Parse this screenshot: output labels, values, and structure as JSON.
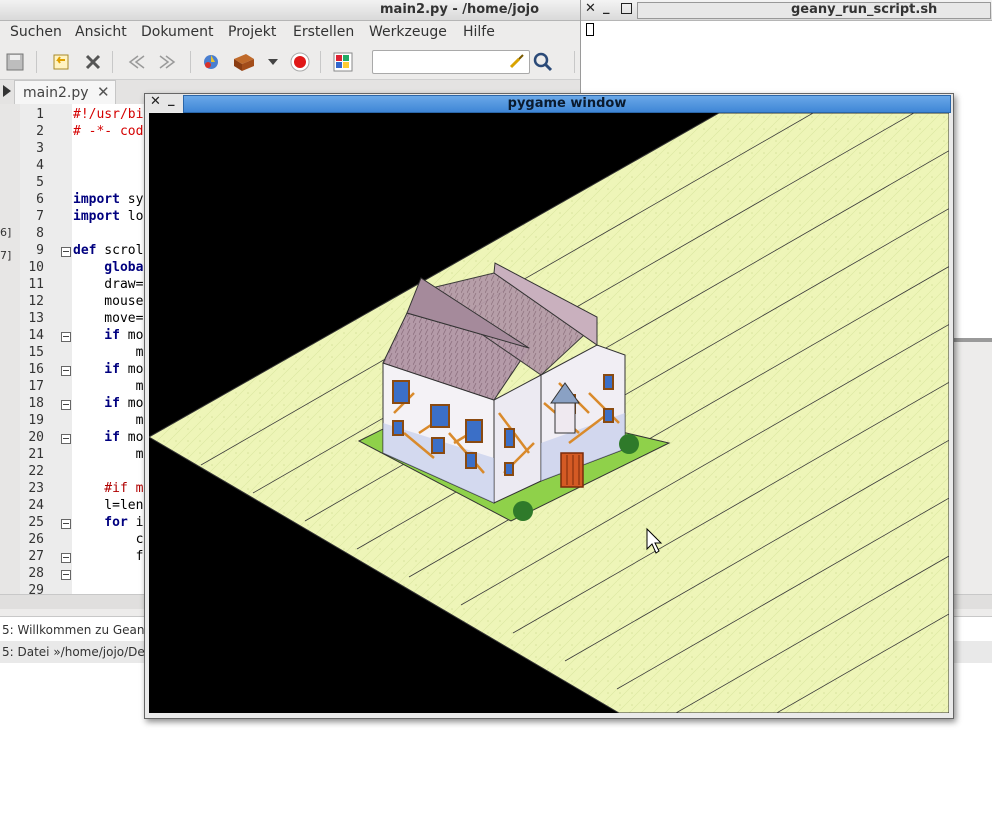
{
  "geany": {
    "title": "main2.py - /home/jojo",
    "menu": [
      "Suchen",
      "Ansicht",
      "Dokument",
      "Projekt",
      "Erstellen",
      "Werkzeuge",
      "Hilfe"
    ],
    "tab_label": "main2.py",
    "left_strip_numbers": [
      "6]",
      "7]"
    ],
    "lines": [
      {
        "n": "1",
        "text": "#!/usr/bi"
      },
      {
        "n": "2",
        "text": "# -*- cod"
      },
      {
        "n": "3",
        "text": ""
      },
      {
        "n": "4",
        "text": ""
      },
      {
        "n": "5",
        "text": ""
      },
      {
        "n": "6",
        "kw": "import",
        "text": " sy"
      },
      {
        "n": "7",
        "kw": "import",
        "text": " lo"
      },
      {
        "n": "8",
        "text": ""
      },
      {
        "n": "9",
        "kw": "def",
        "text": " scrol"
      },
      {
        "n": "10",
        "kw": "    globa",
        "text": ""
      },
      {
        "n": "11",
        "text": "    draw="
      },
      {
        "n": "12",
        "text": "    mouse"
      },
      {
        "n": "13",
        "text": "    move="
      },
      {
        "n": "14",
        "kw": "    if",
        "text": " mo"
      },
      {
        "n": "15",
        "text": "        m"
      },
      {
        "n": "16",
        "kw": "    if",
        "text": " mo"
      },
      {
        "n": "17",
        "text": "        m"
      },
      {
        "n": "18",
        "kw": "    if",
        "text": " mo"
      },
      {
        "n": "19",
        "text": "        m"
      },
      {
        "n": "20",
        "kw": "    if",
        "text": " mo"
      },
      {
        "n": "21",
        "text": "        m"
      },
      {
        "n": "22",
        "text": ""
      },
      {
        "n": "23",
        "text": "    #if m"
      },
      {
        "n": "24",
        "text": "    l=len"
      },
      {
        "n": "25",
        "kw": "    for",
        "text": " i"
      },
      {
        "n": "26",
        "text": "        c"
      },
      {
        "n": "27",
        "text": "        f"
      },
      {
        "n": "28",
        "text": ""
      },
      {
        "n": "29",
        "text": ""
      }
    ],
    "messages": [
      "5: Willkommen zu Gean",
      "5: Datei »/home/jojo/De"
    ]
  },
  "terminal": {
    "title": "geany_run_script.sh"
  },
  "pygame": {
    "title": "pygame window"
  },
  "colors": {
    "grass": "#eef5b8",
    "grass_line": "#3a3a3a",
    "titlebar_blue": "#4a90dd",
    "keyword": "#00007f",
    "comment": "#d40000"
  },
  "icons": [
    "save-icon",
    "revert-icon",
    "close-icon",
    "back-icon",
    "forward-icon",
    "compile-icon",
    "build-icon",
    "stop-icon",
    "color-picker-icon",
    "clear-icon",
    "search-icon"
  ]
}
